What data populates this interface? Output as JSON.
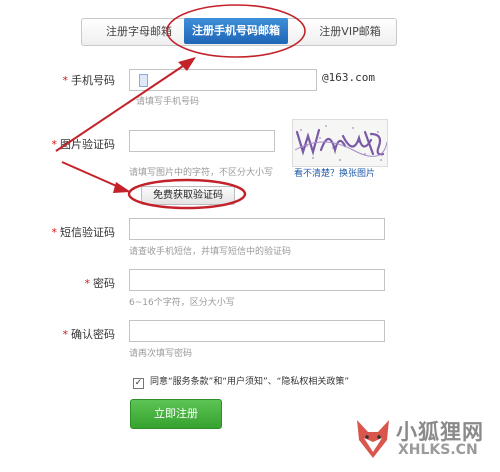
{
  "tabs": {
    "email_label": "注册字母邮箱",
    "mobile_label": "注册手机号码邮箱",
    "vip_label": "注册VIP邮箱"
  },
  "form": {
    "phone": {
      "label": "手机号码",
      "suffix": "@163.com",
      "hint": "请填写手机号码"
    },
    "captcha": {
      "label": "图片验证码",
      "hint": "请填写图片中的字符，不区分大小写",
      "refresh_link": "看不清楚？换张图片",
      "get_code_button": "免费获取验证码"
    },
    "sms": {
      "label": "短信验证码",
      "hint": "请查收手机短信，并填写短信中的验证码"
    },
    "password": {
      "label": "密码",
      "hint": "6~16个字符，区分大小写"
    },
    "confirm": {
      "label": "确认密码",
      "hint": "请再次填写密码"
    },
    "agreement": {
      "checked": true,
      "text": "同意“服务条款”和“用户须知”、“隐私权相关政策”"
    },
    "submit_label": "立即注册"
  },
  "colors": {
    "annotation": "#c3222a",
    "submit": "#3fae37",
    "tab_active": "#2a74c6"
  },
  "watermark": {
    "text": "小狐狸网",
    "sub": "XHLKS.CN"
  }
}
